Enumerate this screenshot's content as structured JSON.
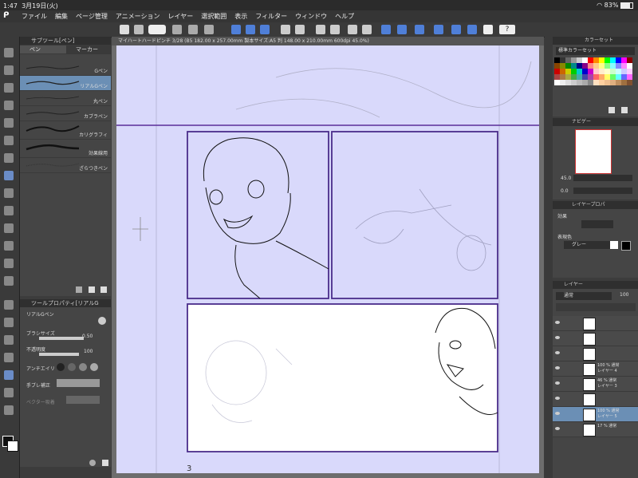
{
  "status": {
    "time": "1:47",
    "date": "3月19日(火)",
    "battery": "83%"
  },
  "menu": [
    "ファイル",
    "編集",
    "ページ管理",
    "アニメーション",
    "レイヤー",
    "選択範囲",
    "表示",
    "フィルター",
    "ウィンドウ",
    "ヘルプ"
  ],
  "subtool": {
    "title": "サブツール[ペン]",
    "tabs": [
      "ペン",
      "マーカー"
    ],
    "brushes": [
      "Gペン",
      "リアルGペン",
      "丸ペン",
      "カブラペン",
      "カリグラフィ",
      "効果線用",
      "ざらつきペン"
    ],
    "selected_index": 1
  },
  "toolprop": {
    "title": "ツールプロパティ[リアルG",
    "tool_name": "リアルGペン",
    "brush_size_label": "ブラシサイズ",
    "brush_size_value": "0.50",
    "opacity_label": "不透明度",
    "opacity_value": "100",
    "antialias_label": "アンチエイリ",
    "stabilization_label": "手ブレ補正",
    "vector_label": "ベクター吸着"
  },
  "canvas": {
    "doc_title": "マイハートハードピンチ 3/28 (B5 182.00 x 257.00mm 製本サイズ:A5 判 148.00 x 210.00mm 600dpi 45.0%)",
    "page_number": "3"
  },
  "colorset": {
    "title": "カラーセット",
    "preset": "標準カラーセット",
    "colors": [
      "#000000",
      "#333333",
      "#666666",
      "#999999",
      "#cccccc",
      "#ffffff",
      "#ff0000",
      "#ff8800",
      "#ffff00",
      "#00ff00",
      "#00ffff",
      "#0000ff",
      "#ff00ff",
      "#880000",
      "#884400",
      "#888800",
      "#008800",
      "#008888",
      "#000088",
      "#880088",
      "#ff8888",
      "#ffcc88",
      "#ffff88",
      "#88ff88",
      "#88ffff",
      "#8888ff",
      "#ff88ff",
      "#ffffff",
      "#cc0000",
      "#cc6600",
      "#cccc00",
      "#00cc00",
      "#00cccc",
      "#0000cc",
      "#cc00cc",
      "#ffcccc",
      "#ffeecc",
      "#ffffcc",
      "#ccffcc",
      "#ccffff",
      "#ccccff",
      "#ffccff",
      "#aa4444",
      "#aa7744",
      "#aaaa44",
      "#44aa44",
      "#44aaaa",
      "#4444aa",
      "#aa44aa",
      "#ff6666",
      "#ffaa66",
      "#ffff66",
      "#66ff66",
      "#66ffff",
      "#6666ff",
      "#ff66ff",
      "#ffffff",
      "#eeeeee",
      "#dddddd",
      "#cccccc",
      "#bbbbbb",
      "#aaaaaa",
      "#888888",
      "#ffe0c0",
      "#ffd0a0",
      "#f0c090",
      "#e0b080",
      "#c09060",
      "#a07040",
      "#805030"
    ]
  },
  "navigator": {
    "title": "ナビゲー",
    "zoom": "45.0",
    "rotate": "0.0"
  },
  "layerprop": {
    "title": "レイヤープロパ",
    "effect_label": "効果",
    "color_label": "表現色",
    "color_value": "グレー"
  },
  "layers": {
    "title": "レイヤー",
    "blend_mode": "通常",
    "opacity": "100",
    "rows": [
      {
        "line1": "",
        "line2": ""
      },
      {
        "line1": "",
        "line2": ""
      },
      {
        "line1": "",
        "line2": ""
      },
      {
        "line1": "100 % 通常",
        "line2": "レイヤー 4"
      },
      {
        "line1": "46 % 通常",
        "line2": "レイヤー 3"
      },
      {
        "line1": "",
        "line2": ""
      },
      {
        "line1": "100 % 通常",
        "line2": "レイヤー 5"
      },
      {
        "line1": "17 % 通常",
        "line2": ""
      }
    ]
  }
}
